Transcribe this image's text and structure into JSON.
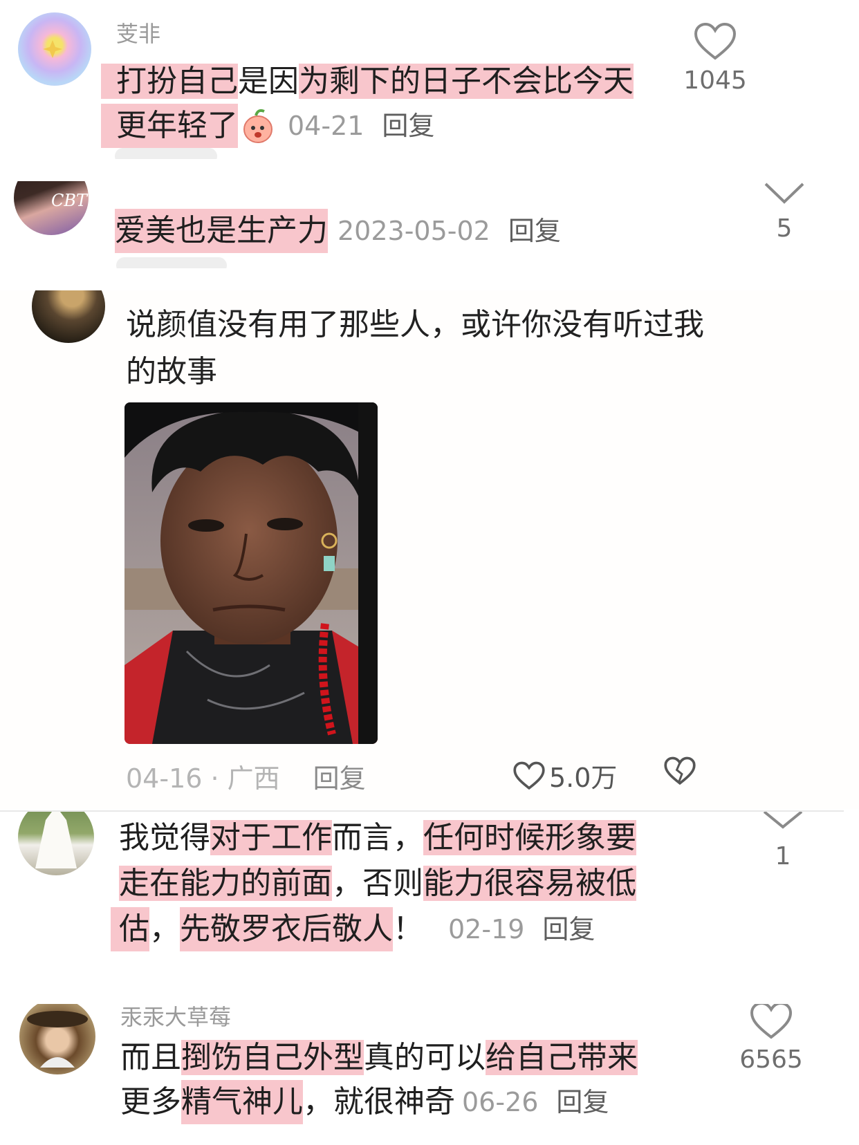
{
  "comments": [
    {
      "username": "芰非",
      "segments": [
        {
          "t": "打扮自己",
          "hl": true
        },
        {
          "t": "是因",
          "hl": false
        },
        {
          "t": "为剩下的日子不会比今天",
          "hl": true
        }
      ],
      "segments2": [
        {
          "t": "更年轻了",
          "hl": true
        }
      ],
      "emoji": "peach-face-emoji",
      "date": "04-21",
      "reply": "回复",
      "likes": "1045"
    },
    {
      "username": "",
      "segments": [
        {
          "t": "爱美也是生产力",
          "hl": true
        }
      ],
      "date": "2023-05-02",
      "reply": "回复",
      "likes": "5"
    },
    {
      "username": "",
      "text1": "说颜值没有用了那些人，或许你没有听过我",
      "text2": "的故事",
      "date_loc": "04-16 · 广西",
      "reply": "回复",
      "likes": "5.0万"
    },
    {
      "username": "",
      "line1": [
        {
          "t": "我觉得",
          "hl": false
        },
        {
          "t": "对于工作",
          "hl": true
        },
        {
          "t": "而言，",
          "hl": false
        },
        {
          "t": "任何时候形象要",
          "hl": true
        }
      ],
      "line2": [
        {
          "t": "走在能力的前面",
          "hl": true
        },
        {
          "t": "，否则",
          "hl": false
        },
        {
          "t": "能力很容易被低",
          "hl": true
        }
      ],
      "line3": [
        {
          "t": "估",
          "hl": true
        },
        {
          "t": "，",
          "hl": false
        },
        {
          "t": "先敬罗衣后敬人",
          "hl": true
        },
        {
          "t": "！",
          "hl": false
        }
      ],
      "date": "02-19",
      "reply": "回复",
      "likes": "1"
    },
    {
      "username": "汞汞大草莓",
      "line1": [
        {
          "t": "而且",
          "hl": false
        },
        {
          "t": "捯饬自己外型",
          "hl": true
        },
        {
          "t": "真的可以",
          "hl": false
        },
        {
          "t": "给自己带来",
          "hl": true
        }
      ],
      "line2": [
        {
          "t": "更多",
          "hl": false
        },
        {
          "t": "精气神儿",
          "hl": true
        },
        {
          "t": "，就很神奇",
          "hl": false
        }
      ],
      "date": "06-26",
      "reply": "回复",
      "likes": "6565"
    }
  ],
  "colors": {
    "highlight": "#f8c6cc",
    "meta": "#9b9b9b",
    "text": "#1f1f1f"
  }
}
